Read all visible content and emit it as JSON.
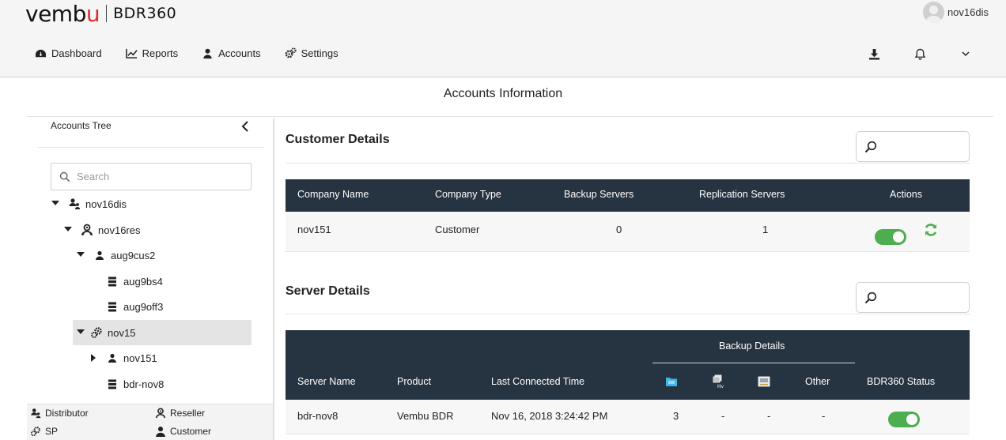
{
  "brand": {
    "logo_prefix": "vemb",
    "logo_accent": "u",
    "product": "BDR360",
    "accent_color": "#e02a2a"
  },
  "user": {
    "name": "nov16dis"
  },
  "nav": [
    {
      "label": "Dashboard",
      "icon": "dashboard-icon"
    },
    {
      "label": "Reports",
      "icon": "chart-line-icon"
    },
    {
      "label": "Accounts",
      "icon": "user-icon"
    },
    {
      "label": "Settings",
      "icon": "gears-icon"
    }
  ],
  "tools": [
    "download-icon",
    "bell-icon",
    "chevron-down-icon"
  ],
  "page_title": "Accounts Information",
  "tree": {
    "heading": "Accounts Tree",
    "search_placeholder": "Search",
    "nodes": [
      {
        "label": "nov16dis",
        "type": "distributor",
        "expanded": true
      },
      {
        "label": "nov16res",
        "type": "reseller",
        "expanded": true
      },
      {
        "label": "aug9cus2",
        "type": "customer",
        "expanded": true
      },
      {
        "label": "aug9bs4",
        "type": "server"
      },
      {
        "label": "aug9off3",
        "type": "server"
      },
      {
        "label": "nov15",
        "type": "sp",
        "expanded": true,
        "selected": true
      },
      {
        "label": "nov151",
        "type": "customer",
        "expanded": false
      },
      {
        "label": "bdr-nov8",
        "type": "server"
      }
    ],
    "legend": {
      "distributor": "Distributor",
      "reseller": "Reseller",
      "sp": "SP",
      "customer": "Customer"
    }
  },
  "customer_details": {
    "title": "Customer Details",
    "headers": {
      "company_name": "Company Name",
      "company_type": "Company Type",
      "backup_servers": "Backup Servers",
      "replication_servers": "Replication Servers",
      "actions": "Actions"
    },
    "rows": [
      {
        "company_name": "nov151",
        "company_type": "Customer",
        "backup_servers": "0",
        "replication_servers": "1",
        "enabled": true
      }
    ]
  },
  "server_details": {
    "title": "Server Details",
    "headers": {
      "server_name": "Server Name",
      "product": "Product",
      "last_connected": "Last Connected Time",
      "backup_details": "Backup Details",
      "other": "Other",
      "status": "BDR360 Status"
    },
    "backup_icons": [
      "folder-icon",
      "hyperv-icon",
      "disk-image-icon"
    ],
    "rows": [
      {
        "server_name": "bdr-nov8",
        "product": "Vembu BDR",
        "last_connected": "Nov 16, 2018 3:24:42 PM",
        "file": "3",
        "hyperv": "-",
        "image": "-",
        "other": "-",
        "status_on": true
      }
    ]
  },
  "colors": {
    "header_bg": "#263340",
    "toggle_on": "#4cae4f",
    "refresh": "#4cae4f"
  }
}
